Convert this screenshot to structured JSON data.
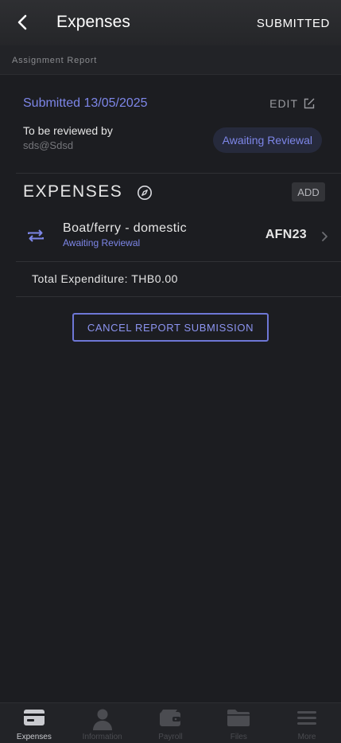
{
  "header": {
    "title": "Expenses",
    "status": "SUBMITTED"
  },
  "section": {
    "label": "Assignment Report"
  },
  "report": {
    "submitted": "Submitted 13/05/2025",
    "edit_label": "EDIT",
    "reviewed_by_label": "To be reviewed by",
    "reviewer": "sds@Sdsd",
    "status_pill": "Awaiting Reviewal"
  },
  "expenses": {
    "heading": "EXPENSES",
    "add_label": "ADD",
    "items": [
      {
        "title": "Boat/ferry - domestic",
        "status": "Awaiting Reviewal",
        "amount": "AFN23"
      }
    ],
    "total": "Total Expenditure: THB0.00"
  },
  "actions": {
    "cancel_label": "CANCEL REPORT SUBMISSION"
  },
  "tabs": [
    {
      "label": "Expenses",
      "icon": "card-icon",
      "active": true
    },
    {
      "label": "Information",
      "icon": "person-icon",
      "active": false
    },
    {
      "label": "Payroll",
      "icon": "wallet-icon",
      "active": false
    },
    {
      "label": "Files",
      "icon": "folder-icon",
      "active": false
    },
    {
      "label": "More",
      "icon": "menu-icon",
      "active": false
    }
  ],
  "colors": {
    "accent": "#7d86e8",
    "background": "#1c1d21",
    "header": "#2a2b2e"
  }
}
